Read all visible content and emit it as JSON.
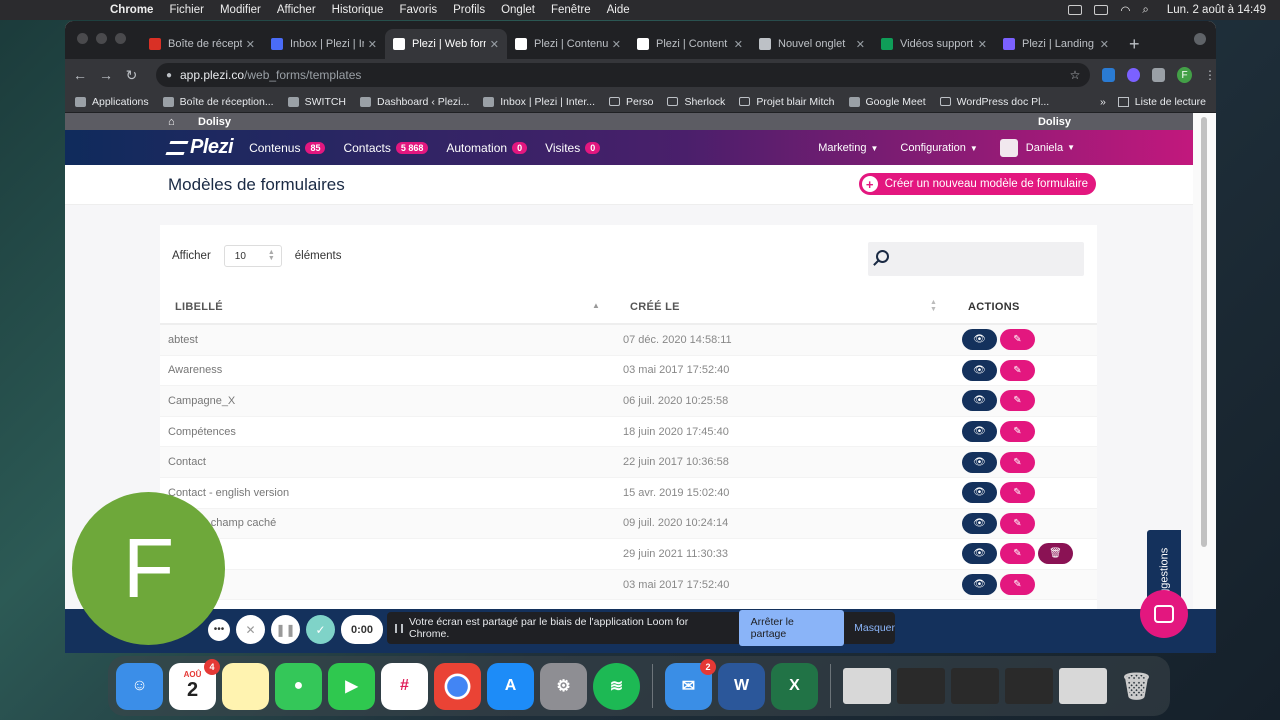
{
  "menubar": {
    "app": "Chrome",
    "items": [
      "Fichier",
      "Modifier",
      "Afficher",
      "Historique",
      "Favoris",
      "Profils",
      "Onglet",
      "Fenêtre",
      "Aide"
    ],
    "clock": "Lun. 2 août à 14:49"
  },
  "browser": {
    "tabs": [
      {
        "label": "Boîte de récept",
        "color": "#d93025"
      },
      {
        "label": "Inbox | Plezi | In",
        "color": "#4a6cf7"
      },
      {
        "label": "Plezi | Web form",
        "color": "#ffffff",
        "active": true
      },
      {
        "label": "Plezi | Contenu",
        "color": "#ffffff"
      },
      {
        "label": "Plezi | Content",
        "color": "#ffffff"
      },
      {
        "label": "Nouvel onglet",
        "color": "#bdc1c6"
      },
      {
        "label": "Vidéos support",
        "color": "#0f9d58"
      },
      {
        "label": "Plezi | Landing",
        "color": "#7b61ff"
      }
    ],
    "url_host": "app.plezi.co",
    "url_path": "/web_forms/templates",
    "profile_initial": "F",
    "bookmarks": [
      {
        "label": "Applications",
        "icon": "apps-icon"
      },
      {
        "label": "Boîte de réception...",
        "icon": "gmail-icon"
      },
      {
        "label": "SWITCH",
        "icon": "plezi-icon"
      },
      {
        "label": "Dashboard ‹ Plezi...",
        "icon": "wordpress-icon"
      },
      {
        "label": "Inbox | Plezi | Inter...",
        "icon": "intercom-icon"
      },
      {
        "label": "Perso",
        "icon": "folder-icon"
      },
      {
        "label": "Sherlock",
        "icon": "folder-icon"
      },
      {
        "label": "Projet blair Mitch",
        "icon": "folder-icon"
      },
      {
        "label": "Google Meet",
        "icon": "meet-icon"
      },
      {
        "label": "WordPress doc Pl...",
        "icon": "folder-icon"
      }
    ],
    "reading_list": "Liste de lecture"
  },
  "app": {
    "org_left": "Dolisy",
    "org_right": "Dolisy",
    "logo": "Plezi",
    "nav": [
      {
        "label": "Contenus",
        "badge": "85"
      },
      {
        "label": "Contacts",
        "badge": "5 868"
      },
      {
        "label": "Automation",
        "badge": "0"
      },
      {
        "label": "Visites",
        "badge": "0"
      }
    ],
    "marketing": "Marketing",
    "configuration": "Configuration",
    "user": "Daniela",
    "page_title": "Modèles de formulaires",
    "create_button": "Créer un nouveau modèle de formulaire",
    "show_label": "Afficher",
    "page_size": "10",
    "elements_label": "éléments",
    "columns": {
      "label": "LIBELLÉ",
      "created": "CRÉÉ LE",
      "actions": "ACTIONS"
    },
    "rows": [
      {
        "label": "abtest",
        "date": "07 déc. 2020 14:58:11",
        "delete": false
      },
      {
        "label": "Awareness",
        "date": "03 mai 2017 17:52:40",
        "delete": false
      },
      {
        "label": "Campagne_X",
        "date": "06 juil. 2020 10:25:58",
        "delete": false
      },
      {
        "label": "Compétences",
        "date": "18 juin 2020 17:45:40",
        "delete": false
      },
      {
        "label": "Contact",
        "date": "22 juin 2017 10:36:58",
        "delete": false
      },
      {
        "label": "Contact - english version",
        "date": "15 avr. 2019 15:02:40",
        "delete": false
      },
      {
        "label": "X Robot champ caché",
        "date": "09 juil. 2020 10:24:14",
        "delete": false
      },
      {
        "label": "",
        "date": "29 juin 2021 11:30:33",
        "delete": true
      },
      {
        "label": "",
        "date": "03 mai 2017 17:52:40",
        "delete": false
      }
    ],
    "suggestions": "Suggestions"
  },
  "loom": {
    "timer": "0:00",
    "notice": "Votre écran est partagé par le biais de l'application Loom for Chrome.",
    "stop": "Arrêter le partage",
    "hide": "Masquer",
    "avatar_initial": "F"
  },
  "dock": {
    "calendar_month": "AOÛ",
    "calendar_day": "2",
    "calendar_badge": "4",
    "mail_badge": "2"
  }
}
